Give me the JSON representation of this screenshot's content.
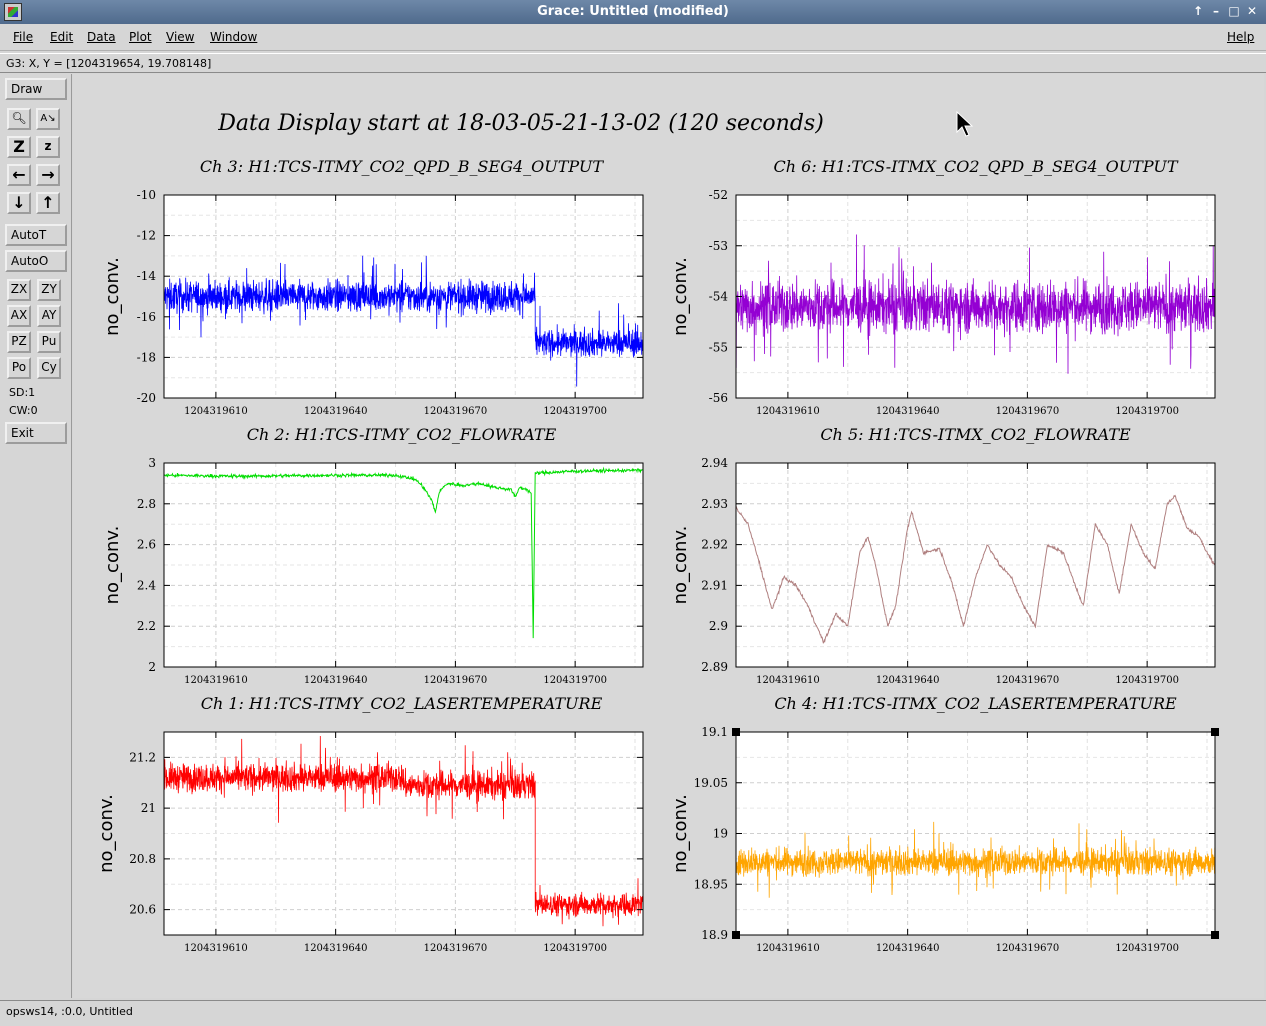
{
  "window": {
    "title": "Grace: Untitled (modified)"
  },
  "menus": [
    "File",
    "Edit",
    "Data",
    "Plot",
    "View",
    "Window"
  ],
  "help_label": "Help",
  "locator": "G3: X, Y = [1204319654, 19.708148]",
  "toolbar": {
    "draw": "Draw",
    "autot": "AutoT",
    "autoo": "AutoO",
    "zx": "ZX",
    "zy": "ZY",
    "ax": "AX",
    "ay": "AY",
    "pz": "PZ",
    "pu": "Pu",
    "po": "Po",
    "cy": "Cy",
    "sd": "SD:1",
    "cw": "CW:0",
    "exit": "Exit"
  },
  "status": "opsws14, :0.0, Untitled",
  "colors": {
    "blue": "#0000ff",
    "purple": "#9400d3",
    "green": "#00dd00",
    "brown": "#b08080",
    "red": "#ff0000",
    "orange": "#ffa500"
  },
  "main_title": "Data Display start at 18-03-05-21-13-02 (120 seconds)",
  "chart_data": [
    {
      "type": "line",
      "title": "Ch 3: H1:TCS-ITMY_CO2_QPD_B_SEG4_OUTPUT",
      "ylabel": "no_conv.",
      "color": "#0000ff",
      "ylim": [
        -20,
        -10
      ],
      "yticks": [
        "-10",
        "-12",
        "-14",
        "-16",
        "-18",
        "-20"
      ],
      "yvals": [
        -10,
        -12,
        -14,
        -16,
        -18,
        -20
      ],
      "xlim": [
        1204319597,
        1204319717
      ],
      "xticks": [
        "1204319610",
        "1204319640",
        "1204319670",
        "1204319700"
      ],
      "segments": [
        {
          "x0": 1204319597,
          "x1": 1204319690,
          "mean": -15.0,
          "noise": 0.7
        },
        {
          "x0": 1204319690,
          "x1": 1204319717,
          "mean": -17.3,
          "noise": 0.6
        }
      ]
    },
    {
      "type": "line",
      "title": "Ch 6: H1:TCS-ITMX_CO2_QPD_B_SEG4_OUTPUT",
      "ylabel": "no_conv.",
      "color": "#9400d3",
      "ylim": [
        -56,
        -52
      ],
      "yticks": [
        "-52",
        "-53",
        "-54",
        "-55",
        "-56"
      ],
      "yvals": [
        -52,
        -53,
        -54,
        -55,
        -56
      ],
      "xlim": [
        1204319597,
        1204319717
      ],
      "xticks": [
        "1204319610",
        "1204319640",
        "1204319670",
        "1204319700"
      ],
      "segments": [
        {
          "x0": 1204319597,
          "x1": 1204319717,
          "mean": -54.2,
          "noise": 0.45
        }
      ]
    },
    {
      "type": "line",
      "title": "Ch 2: H1:TCS-ITMY_CO2_FLOWRATE",
      "ylabel": "no_conv.",
      "color": "#00dd00",
      "ylim": [
        2,
        3
      ],
      "yticks": [
        "3",
        "2.8",
        "2.6",
        "2.4",
        "2.2",
        "2"
      ],
      "yvals": [
        3,
        2.8,
        2.6,
        2.4,
        2.2,
        2
      ],
      "xlim": [
        1204319597,
        1204319717
      ],
      "xticks": [
        "1204319610",
        "1204319640",
        "1204319670",
        "1204319700"
      ],
      "points": [
        [
          1204319597,
          2.94
        ],
        [
          1204319615,
          2.935
        ],
        [
          1204319640,
          2.94
        ],
        [
          1204319655,
          2.94
        ],
        [
          1204319660,
          2.92
        ],
        [
          1204319662,
          2.88
        ],
        [
          1204319664,
          2.82
        ],
        [
          1204319665,
          2.76
        ],
        [
          1204319666,
          2.86
        ],
        [
          1204319668,
          2.9
        ],
        [
          1204319672,
          2.89
        ],
        [
          1204319676,
          2.9
        ],
        [
          1204319680,
          2.88
        ],
        [
          1204319684,
          2.87
        ],
        [
          1204319685,
          2.83
        ],
        [
          1204319686,
          2.88
        ],
        [
          1204319688,
          2.87
        ],
        [
          1204319689,
          2.85
        ],
        [
          1204319689.5,
          2.14
        ],
        [
          1204319690,
          2.95
        ],
        [
          1204319700,
          2.96
        ],
        [
          1204319717,
          2.965
        ]
      ]
    },
    {
      "type": "line",
      "title": "Ch 5: H1:TCS-ITMX_CO2_FLOWRATE",
      "ylabel": "no_conv.",
      "color": "#b08080",
      "ylim": [
        2.89,
        2.94
      ],
      "yticks": [
        "2.94",
        "2.93",
        "2.92",
        "2.91",
        "2.9",
        "2.89"
      ],
      "yvals": [
        2.94,
        2.93,
        2.92,
        2.91,
        2.9,
        2.89
      ],
      "xlim": [
        1204319597,
        1204319717
      ],
      "xticks": [
        "1204319610",
        "1204319640",
        "1204319670",
        "1204319700"
      ],
      "points": [
        [
          1204319597,
          2.929
        ],
        [
          1204319600,
          2.925
        ],
        [
          1204319603,
          2.915
        ],
        [
          1204319606,
          2.904
        ],
        [
          1204319609,
          2.912
        ],
        [
          1204319612,
          2.91
        ],
        [
          1204319615,
          2.905
        ],
        [
          1204319619,
          2.896
        ],
        [
          1204319622,
          2.903
        ],
        [
          1204319625,
          2.9
        ],
        [
          1204319628,
          2.918
        ],
        [
          1204319630,
          2.922
        ],
        [
          1204319632,
          2.915
        ],
        [
          1204319635,
          2.9
        ],
        [
          1204319637,
          2.905
        ],
        [
          1204319640,
          2.924
        ],
        [
          1204319641,
          2.928
        ],
        [
          1204319644,
          2.918
        ],
        [
          1204319648,
          2.919
        ],
        [
          1204319651,
          2.911
        ],
        [
          1204319654,
          2.9
        ],
        [
          1204319657,
          2.912
        ],
        [
          1204319660,
          2.92
        ],
        [
          1204319663,
          2.915
        ],
        [
          1204319666,
          2.912
        ],
        [
          1204319669,
          2.905
        ],
        [
          1204319672,
          2.9
        ],
        [
          1204319675,
          2.92
        ],
        [
          1204319679,
          2.918
        ],
        [
          1204319682,
          2.91
        ],
        [
          1204319684,
          2.905
        ],
        [
          1204319687,
          2.925
        ],
        [
          1204319690,
          2.92
        ],
        [
          1204319693,
          2.908
        ],
        [
          1204319696,
          2.925
        ],
        [
          1204319699,
          2.918
        ],
        [
          1204319702,
          2.914
        ],
        [
          1204319705,
          2.93
        ],
        [
          1204319707,
          2.932
        ],
        [
          1204319710,
          2.924
        ],
        [
          1204319713,
          2.922
        ],
        [
          1204319715,
          2.918
        ],
        [
          1204319717,
          2.915
        ]
      ]
    },
    {
      "type": "line",
      "title": "Ch 1: H1:TCS-ITMY_CO2_LASERTEMPERATURE",
      "ylabel": "no_conv.",
      "color": "#ff0000",
      "ylim": [
        20.5,
        21.3
      ],
      "yticks": [
        "21.2",
        "21",
        "20.8",
        "20.6"
      ],
      "yvals": [
        21.2,
        21,
        20.8,
        20.6
      ],
      "xlim": [
        1204319597,
        1204319717
      ],
      "xticks": [
        "1204319610",
        "1204319640",
        "1204319670",
        "1204319700"
      ],
      "segments": [
        {
          "x0": 1204319597,
          "x1": 1204319657,
          "mean": 21.12,
          "noise": 0.05
        },
        {
          "x0": 1204319657,
          "x1": 1204319690,
          "mean": 21.09,
          "noise": 0.05
        },
        {
          "x0": 1204319690,
          "x1": 1204319717,
          "mean": 20.62,
          "noise": 0.04
        }
      ]
    },
    {
      "type": "line",
      "title": "Ch 4: H1:TCS-ITMX_CO2_LASERTEMPERATURE",
      "ylabel": "no_conv.",
      "color": "#ffa500",
      "ylim": [
        18.9,
        19.1
      ],
      "yticks": [
        "19.1",
        "19.05",
        "19",
        "18.95",
        "18.9"
      ],
      "yvals": [
        19.1,
        19.05,
        19,
        18.95,
        18.9
      ],
      "xlim": [
        1204319597,
        1204319717
      ],
      "xticks": [
        "1204319610",
        "1204319640",
        "1204319670",
        "1204319700"
      ],
      "segments": [
        {
          "x0": 1204319597,
          "x1": 1204319717,
          "mean": 18.972,
          "noise": 0.012
        }
      ]
    }
  ]
}
